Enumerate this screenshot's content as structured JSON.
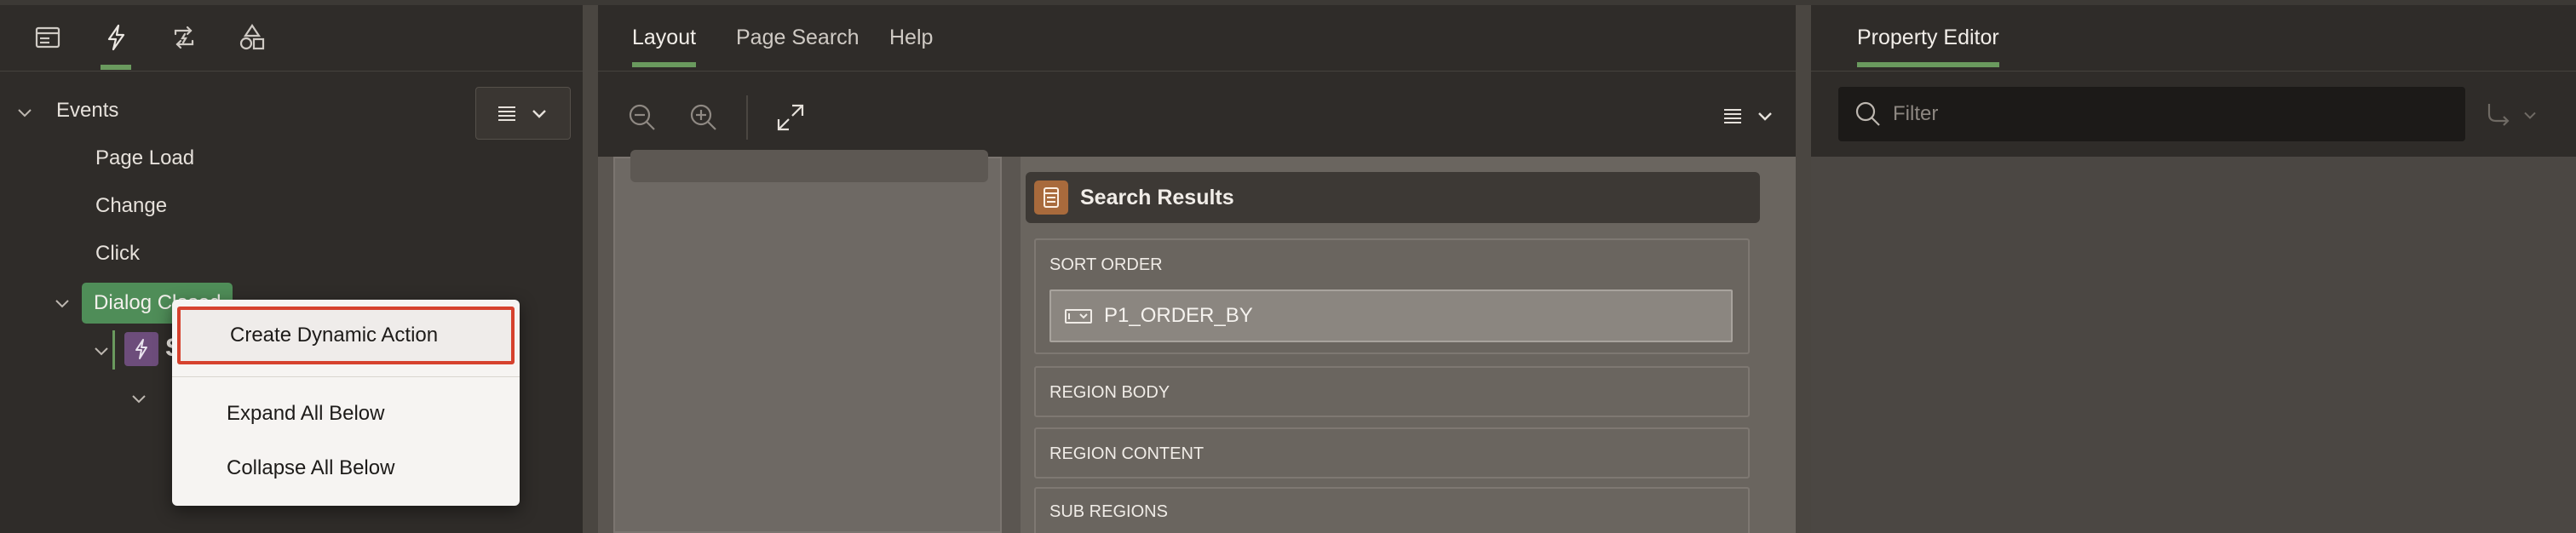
{
  "left_panel": {
    "tabs": [
      {
        "icon": "rendering-tree-icon"
      },
      {
        "icon": "dynamic-actions-icon"
      },
      {
        "icon": "processing-icon"
      },
      {
        "icon": "shared-components-icon"
      }
    ],
    "tree": {
      "root": "Events",
      "items": [
        "Page Load",
        "Change",
        "Click"
      ],
      "selected": "Dialog Closed",
      "child_partial": "S"
    }
  },
  "context_menu": {
    "items": [
      "Create Dynamic Action",
      "Expand All Below",
      "Collapse All Below"
    ]
  },
  "layout_panel": {
    "tabs": [
      "Layout",
      "Page Search",
      "Help"
    ],
    "region_title": "Search Results",
    "slots": [
      "SORT ORDER",
      "REGION BODY",
      "REGION CONTENT",
      "SUB REGIONS"
    ],
    "sort_item": "P1_ORDER_BY"
  },
  "property_editor": {
    "tab": "Property Editor",
    "filter_placeholder": "Filter"
  },
  "colors": {
    "accent_green": "#6a9a5e",
    "selected_node": "#4f8d58",
    "highlight_border": "#d6422e",
    "dynamic_action_icon": "#6d4d7b",
    "region_icon": "#a86a3c"
  }
}
